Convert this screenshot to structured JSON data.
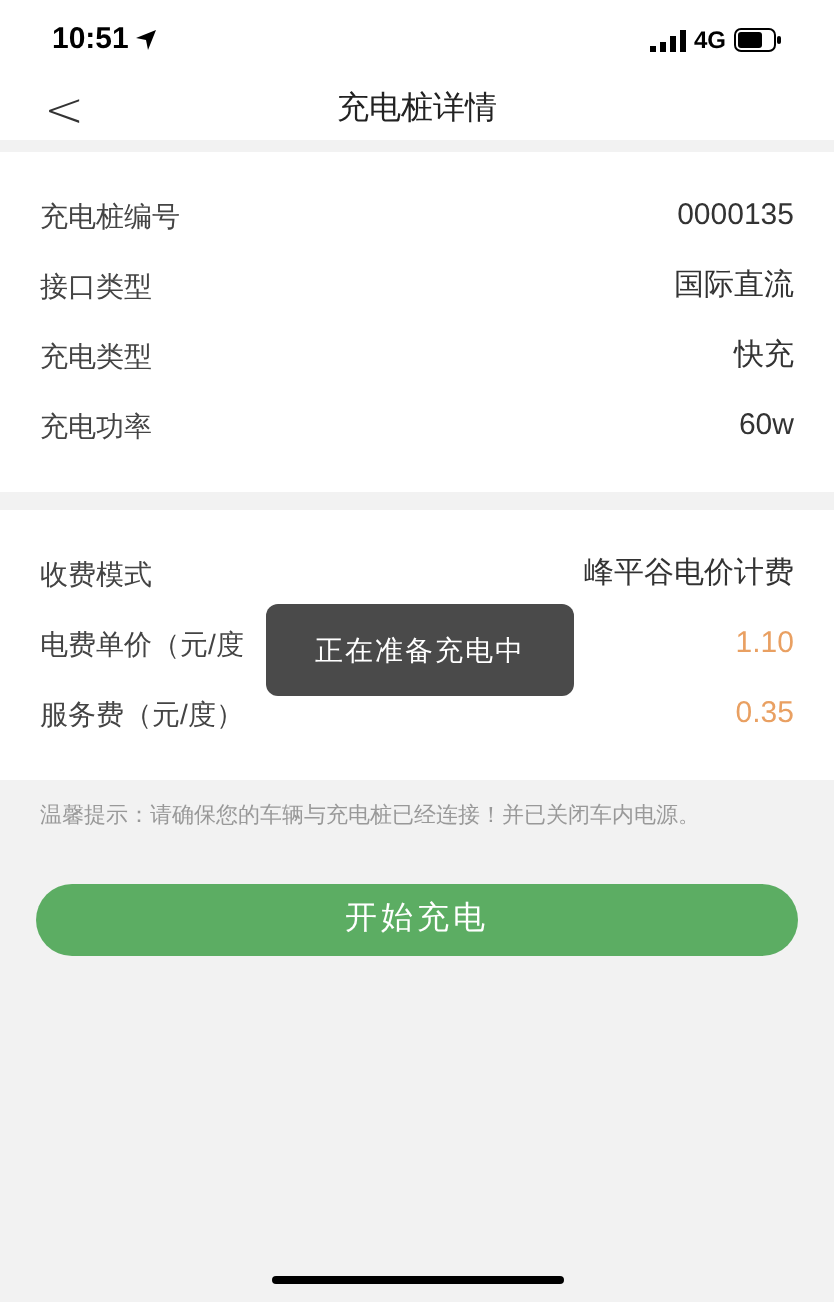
{
  "status_bar": {
    "time": "10:51",
    "network": "4G"
  },
  "nav": {
    "back": "<",
    "title": "充电桩详情"
  },
  "sections": [
    {
      "rows": [
        {
          "label": "充电桩编号",
          "value": "0000135",
          "highlight": false
        },
        {
          "label": "接口类型",
          "value": "国际直流",
          "highlight": false
        },
        {
          "label": "充电类型",
          "value": "快充",
          "highlight": false
        },
        {
          "label": "充电功率",
          "value": "60w",
          "highlight": false
        }
      ]
    },
    {
      "rows": [
        {
          "label": "收费模式",
          "value": "峰平谷电价计费",
          "highlight": false
        },
        {
          "label": "电费单价（元/度",
          "value": "1.10",
          "highlight": true
        },
        {
          "label": "服务费（元/度）",
          "value": "0.35",
          "highlight": true
        }
      ]
    }
  ],
  "notice": "温馨提示：请确保您的车辆与充电桩已经连接！并已关闭车内电源。",
  "toast": "正在准备充电中",
  "start_button": "开始充电"
}
